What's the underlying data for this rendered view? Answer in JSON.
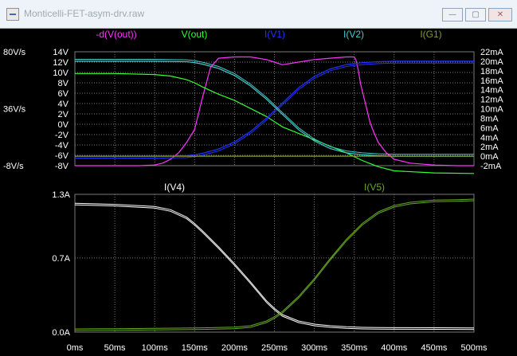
{
  "window": {
    "title": "Monticelli-FET-asym-drv.raw",
    "buttons": {
      "minimize": "—",
      "maximize": "▢",
      "close": "✕"
    }
  },
  "colors": {
    "background": "#000000",
    "grid": "#7a7a7a",
    "axis_text": "#ffffff",
    "dVout": "#ff33ff",
    "Vout": "#33ff33",
    "IV1": "#2233ff",
    "IV2": "#44cccc",
    "IG1": "#889933",
    "IV4": "#ffffff",
    "IV5": "#66aa22"
  },
  "chart_data": [
    {
      "type": "line",
      "panel": "top",
      "x_unit": "ms",
      "xlim": [
        0,
        500
      ],
      "left_axis_outer": {
        "ticks": [
          "80V/s",
          "36V/s",
          "-8V/s"
        ],
        "range": [
          -8,
          80
        ]
      },
      "left_axis_inner": {
        "ticks": [
          "14V",
          "12V",
          "10V",
          "8V",
          "6V",
          "4V",
          "2V",
          "0V",
          "-2V",
          "-4V",
          "-6V",
          "-8V"
        ],
        "range": [
          -8,
          14
        ]
      },
      "right_axis": {
        "ticks": [
          "22mA",
          "20mA",
          "18mA",
          "16mA",
          "14mA",
          "12mA",
          "10mA",
          "8mA",
          "6mA",
          "4mA",
          "2mA",
          "0mA",
          "-2mA"
        ],
        "range": [
          -2,
          22
        ]
      },
      "legend": [
        "-d(V(out))",
        "V(out)",
        "I(V1)",
        "I(V2)",
        "I(G1)"
      ],
      "series": [
        {
          "name": "-d(V(out))",
          "axis": "V/s",
          "x": [
            0,
            80,
            100,
            110,
            120,
            130,
            140,
            150,
            160,
            170,
            180,
            200,
            220,
            240,
            250,
            260,
            280,
            300,
            320,
            340,
            350,
            352,
            355,
            358,
            362,
            366,
            370,
            375,
            380,
            390,
            400,
            420,
            450,
            480,
            500
          ],
          "y": [
            -8,
            -8,
            -7.5,
            -6,
            -3,
            2,
            10,
            20,
            45,
            68,
            75,
            76,
            76,
            74,
            72,
            70,
            72,
            74,
            75,
            76,
            76,
            74,
            66,
            55,
            45,
            35,
            25,
            17,
            10,
            2,
            -3,
            -6,
            -7.5,
            -8,
            -8
          ]
        },
        {
          "name": "V(out)",
          "axis": "V",
          "x": [
            0,
            50,
            100,
            120,
            140,
            150,
            160,
            180,
            200,
            240,
            250,
            260,
            300,
            340,
            360,
            370,
            380,
            400,
            450,
            500
          ],
          "y": [
            9.8,
            9.8,
            9.6,
            9.3,
            8.6,
            8.0,
            7.2,
            5.8,
            4.6,
            1.5,
            0.5,
            -0.5,
            -3.0,
            -5.5,
            -7.0,
            -7.6,
            -8.2,
            -9.0,
            -9.4,
            -9.5
          ]
        },
        {
          "name": "I(V1)",
          "axis": "mA",
          "x": [
            0,
            100,
            140,
            150,
            160,
            180,
            200,
            220,
            240,
            250,
            260,
            280,
            300,
            320,
            340,
            360,
            380,
            400,
            450,
            500
          ],
          "y": [
            0,
            0,
            0.1,
            0.3,
            0.6,
            1.5,
            3.0,
            5.2,
            8.0,
            9.6,
            11.2,
            14.4,
            16.8,
            18.4,
            19.3,
            19.7,
            19.9,
            20,
            20,
            20
          ],
          "pair_offset": -0.4
        },
        {
          "name": "I(V2)",
          "axis": "mA",
          "x": [
            0,
            100,
            140,
            150,
            160,
            180,
            200,
            220,
            240,
            250,
            260,
            280,
            300,
            320,
            340,
            360,
            380,
            400,
            450,
            500
          ],
          "y": [
            20,
            20,
            19.9,
            19.7,
            19.4,
            18.5,
            17.0,
            14.8,
            12.0,
            10.4,
            8.8,
            5.6,
            3.2,
            1.6,
            0.7,
            0.3,
            0.1,
            0,
            0,
            0
          ],
          "pair_offset": 0.4
        },
        {
          "name": "I(G1)",
          "axis": "mA",
          "x": [
            0,
            500
          ],
          "y": [
            0,
            0
          ]
        }
      ]
    },
    {
      "type": "line",
      "panel": "bottom",
      "x_unit": "ms",
      "xlim": [
        0,
        500
      ],
      "ylim": [
        0,
        1.3
      ],
      "y_ticks": [
        "1.3A",
        "0.7A",
        "0.0A"
      ],
      "x_ticks": [
        "0ms",
        "50ms",
        "100ms",
        "150ms",
        "200ms",
        "250ms",
        "300ms",
        "350ms",
        "400ms",
        "450ms",
        "500ms"
      ],
      "legend": [
        "I(V4)",
        "I(V5)"
      ],
      "series": [
        {
          "name": "I(V4)",
          "x": [
            0,
            50,
            100,
            120,
            140,
            150,
            160,
            180,
            200,
            220,
            240,
            250,
            260,
            280,
            300,
            320,
            340,
            360,
            380,
            400,
            450,
            500
          ],
          "y": [
            1.2,
            1.19,
            1.17,
            1.14,
            1.07,
            1.01,
            0.94,
            0.79,
            0.63,
            0.46,
            0.28,
            0.21,
            0.15,
            0.09,
            0.06,
            0.045,
            0.035,
            0.03,
            0.028,
            0.027,
            0.026,
            0.025
          ],
          "pair_offset": 0.015
        },
        {
          "name": "I(V5)",
          "x": [
            0,
            50,
            100,
            150,
            200,
            220,
            240,
            250,
            260,
            280,
            300,
            320,
            340,
            360,
            380,
            400,
            420,
            450,
            480,
            500
          ],
          "y": [
            0.015,
            0.017,
            0.02,
            0.024,
            0.032,
            0.045,
            0.09,
            0.13,
            0.18,
            0.32,
            0.49,
            0.68,
            0.86,
            1.01,
            1.12,
            1.18,
            1.21,
            1.23,
            1.235,
            1.24
          ],
          "pair_offset": 0.015
        }
      ]
    }
  ]
}
